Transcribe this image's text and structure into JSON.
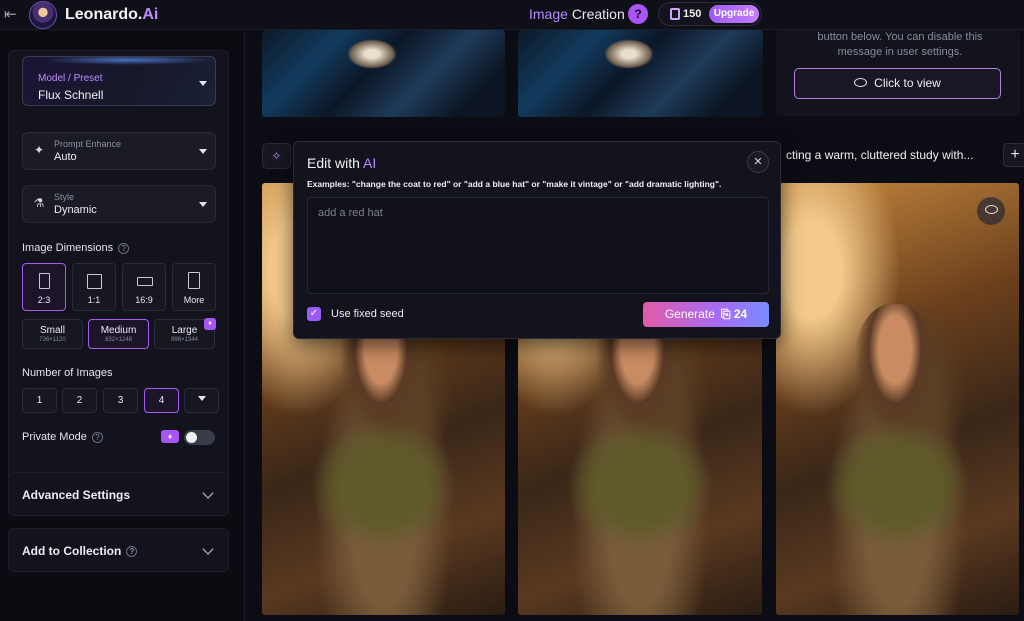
{
  "header": {
    "app_name": "Leonardo.",
    "app_name_suffix": "Ai",
    "page_title_accent": "Image",
    "page_title_rest": "Creation",
    "help": "?",
    "tokens": "150",
    "upgrade_label": "Upgrade"
  },
  "sidebar": {
    "model_label": "Model / Preset",
    "model_value": "Flux Schnell",
    "prompt_enhance_label": "Prompt Enhance",
    "prompt_enhance_value": "Auto",
    "style_label": "Style",
    "style_value": "Dynamic",
    "image_dimensions_title": "Image Dimensions",
    "ratios": [
      {
        "label": "2:3",
        "active": true
      },
      {
        "label": "1:1",
        "active": false
      },
      {
        "label": "16:9",
        "active": false
      },
      {
        "label": "More",
        "active": false
      }
    ],
    "sizes": [
      {
        "name": "Small",
        "dims": "736×1120"
      },
      {
        "name": "Medium",
        "dims": "832×1248"
      },
      {
        "name": "Large",
        "dims": "896×1344"
      }
    ],
    "num_images_title": "Number of Images",
    "num_options": [
      "1",
      "2",
      "3",
      "4"
    ],
    "num_selected": "4",
    "private_mode_label": "Private Mode",
    "advanced_settings_label": "Advanced Settings",
    "add_to_collection_label": "Add to Collection"
  },
  "main": {
    "view_message_line1": "button below. You can disable this",
    "view_message_line2": "message in user settings.",
    "click_to_view_label": "Click to view",
    "prompt_preview": "cting a warm, cluttered study with..."
  },
  "edit_modal": {
    "title": "Edit with",
    "title_accent": "AI",
    "close": "✕",
    "examples": "Examples: \"change the coat to red\" or \"add a blue hat\" or \"make it vintage\" or \"add dramatic lighting\".",
    "placeholder": "add a red hat",
    "use_fixed_seed_label": "Use fixed seed",
    "use_fixed_seed_checked": true,
    "generate_label": "Generate",
    "generate_cost": "24"
  },
  "colors": {
    "accent": "#a855f7",
    "generate_gradient_start": "#e15ba9",
    "generate_gradient_end": "#7a8cff"
  }
}
